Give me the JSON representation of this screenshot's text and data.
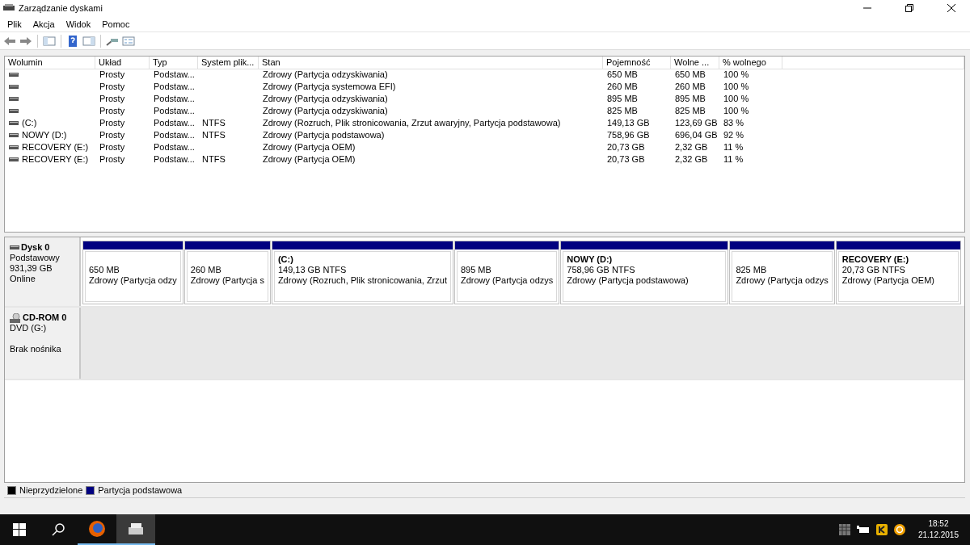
{
  "window": {
    "title": "Zarządzanie dyskami"
  },
  "menu": [
    "Plik",
    "Akcja",
    "Widok",
    "Pomoc"
  ],
  "table": {
    "columns": [
      "Wolumin",
      "Układ",
      "Typ",
      "System plik...",
      "Stan",
      "Pojemność",
      "Wolne ...",
      "% wolnego"
    ],
    "rows": [
      {
        "cells": [
          "",
          "Prosty",
          "Podstaw...",
          "",
          "Zdrowy (Partycja odzyskiwania)",
          "650 MB",
          "650 MB",
          "100 %"
        ]
      },
      {
        "cells": [
          "",
          "Prosty",
          "Podstaw...",
          "",
          "Zdrowy (Partycja systemowa EFI)",
          "260 MB",
          "260 MB",
          "100 %"
        ]
      },
      {
        "cells": [
          "",
          "Prosty",
          "Podstaw...",
          "",
          "Zdrowy (Partycja odzyskiwania)",
          "895 MB",
          "895 MB",
          "100 %"
        ]
      },
      {
        "cells": [
          "",
          "Prosty",
          "Podstaw...",
          "",
          "Zdrowy (Partycja odzyskiwania)",
          "825 MB",
          "825 MB",
          "100 %"
        ]
      },
      {
        "cells": [
          "(C:)",
          "Prosty",
          "Podstaw...",
          "NTFS",
          "Zdrowy (Rozruch, Plik stronicowania, Zrzut awaryjny, Partycja podstawowa)",
          "149,13 GB",
          "123,69 GB",
          "83 %"
        ]
      },
      {
        "cells": [
          "NOWY (D:)",
          "Prosty",
          "Podstaw...",
          "NTFS",
          "Zdrowy (Partycja podstawowa)",
          "758,96 GB",
          "696,04 GB",
          "92 %"
        ]
      },
      {
        "cells": [
          "RECOVERY (E:)",
          "Prosty",
          "Podstaw...",
          "",
          "Zdrowy (Partycja OEM)",
          "20,73 GB",
          "2,32 GB",
          "11 %"
        ]
      },
      {
        "cells": [
          "RECOVERY (E:)",
          "Prosty",
          "Podstaw...",
          "NTFS",
          "Zdrowy (Partycja OEM)",
          "20,73 GB",
          "2,32 GB",
          "11 %"
        ]
      }
    ]
  },
  "disks": [
    {
      "kind": "disk",
      "name": "Dysk 0",
      "lines": [
        "Podstawowy",
        "931,39 GB",
        "Online"
      ],
      "partitions": [
        {
          "size": "650 MB",
          "status": "Zdrowy (Partycja odzy"
        },
        {
          "size": "260 MB",
          "status": "Zdrowy (Partycja s"
        },
        {
          "label": "(C:)",
          "size": "149,13 GB NTFS",
          "status": "Zdrowy (Rozruch, Plik stronicowania, Zrzut"
        },
        {
          "size": "895 MB",
          "status": "Zdrowy (Partycja odzys"
        },
        {
          "label": "NOWY  (D:)",
          "size": "758,96 GB NTFS",
          "status": "Zdrowy (Partycja podstawowa)"
        },
        {
          "size": "825 MB",
          "status": "Zdrowy (Partycja odzys"
        },
        {
          "label": "RECOVERY  (E:)",
          "size": "20,73 GB NTFS",
          "status": "Zdrowy (Partycja OEM)"
        }
      ]
    },
    {
      "kind": "cdrom",
      "name": "CD-ROM 0",
      "lines": [
        "DVD (G:)",
        "Brak nośnika"
      ]
    }
  ],
  "legend": [
    {
      "label": "Nieprzydzielone",
      "color": "#000000"
    },
    {
      "label": "Partycja podstawowa",
      "color": "#000080"
    }
  ],
  "taskbar": {
    "time": "18:52",
    "date": "21.12.2015"
  }
}
